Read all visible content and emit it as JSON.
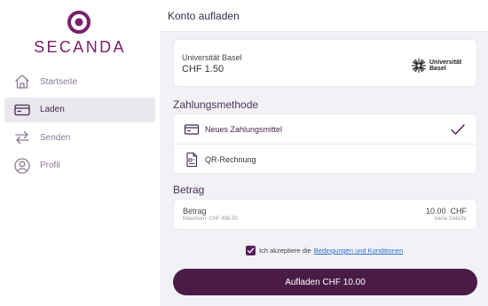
{
  "brand": {
    "name": "SECANDA",
    "color": "#7a1f6b"
  },
  "sidebar": {
    "items": [
      {
        "label": "Startseite",
        "icon": "home-icon",
        "active": false
      },
      {
        "label": "Laden",
        "icon": "card-icon",
        "active": true
      },
      {
        "label": "Senden",
        "icon": "transfer-arrows-icon",
        "active": false
      },
      {
        "label": "Profil",
        "icon": "user-icon",
        "active": false
      }
    ]
  },
  "header": {
    "title": "Konto aufladen"
  },
  "merchant": {
    "name": "Universität Basel",
    "amount": "CHF 1.50",
    "logo_icon": "universitaet-basel-logo",
    "logo_text_1": "Universität",
    "logo_text_2": "Basel"
  },
  "payment_method": {
    "title": "Zahlungsmethode",
    "options": [
      {
        "label": "Neues Zahlungsmittel",
        "icon": "card-icon",
        "selected": true
      },
      {
        "label": "QR-Rechnung",
        "icon": "qr-bill-icon",
        "selected": false
      }
    ]
  },
  "amount": {
    "title": "Betrag",
    "label": "Betrag",
    "max": "Maximum: CHF 498.50",
    "value": "10.00  CHF",
    "fee": "keine Gebühr"
  },
  "terms": {
    "checked": true,
    "text": "Ich akzeptiere die",
    "link": "Bedingungen und Konditionen"
  },
  "submit": {
    "label": "Aufladen CHF 10.00",
    "color": "#4a1b47"
  }
}
